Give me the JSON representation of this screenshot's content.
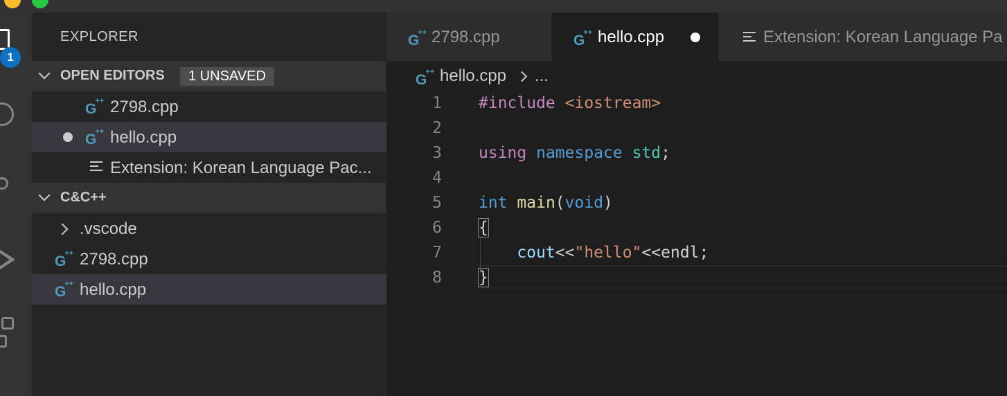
{
  "window": {
    "traffic_lights": [
      "#fdbc2e",
      "#28c840"
    ]
  },
  "activity_bar": {
    "explorer_badge": "1",
    "icons": [
      "files-icon",
      "search-icon",
      "source-control-icon",
      "debug-icon",
      "extensions-icon"
    ]
  },
  "sidebar": {
    "title": "EXPLORER",
    "open_editors": {
      "label": "OPEN EDITORS",
      "badge": "1 UNSAVED",
      "items": [
        {
          "label": "2798.cpp",
          "icon": "cpp-icon",
          "dirty": false
        },
        {
          "label": "hello.cpp",
          "icon": "cpp-icon",
          "dirty": true
        },
        {
          "label": "Extension: Korean Language Pac...",
          "icon": "preview-icon",
          "dirty": false
        }
      ]
    },
    "folder": {
      "label": "C&C++",
      "items": [
        {
          "label": ".vscode",
          "type": "folder",
          "expanded": false
        },
        {
          "label": "2798.cpp",
          "type": "file"
        },
        {
          "label": "hello.cpp",
          "type": "file",
          "selected": true
        }
      ]
    }
  },
  "tabs": [
    {
      "label": "2798.cpp",
      "active": false
    },
    {
      "label": "hello.cpp",
      "active": true,
      "dirty": true
    },
    {
      "label": "Extension: Korean Language Pa",
      "active": false
    }
  ],
  "breadcrumb": {
    "file": "hello.cpp",
    "rest": "..."
  },
  "editor": {
    "line_numbers": [
      "1",
      "2",
      "3",
      "4",
      "5",
      "6",
      "7",
      "8"
    ],
    "code": {
      "l1_directive": "#include",
      "l1_header": "<iostream>",
      "l3_using": "using",
      "l3_namespace": "namespace",
      "l3_std": "std",
      "l3_semi": ";",
      "l5_int": "int",
      "l5_main": "main",
      "l5_open": "(",
      "l5_void": "void",
      "l5_close": ")",
      "l6_brace": "{",
      "l7_indent": "    ",
      "l7_cout": "cout",
      "l7_op1": "<<",
      "l7_str": "\"hello\"",
      "l7_op2": "<<",
      "l7_endl": "endl",
      "l7_semi": ";",
      "l8_brace": "}"
    }
  },
  "colors": {
    "editor_bg": "#1e1e1e",
    "sidebar_bg": "#252526",
    "activity_bg": "#333333",
    "badge": "#0e70c0",
    "cpp_icon": "#519aba"
  }
}
